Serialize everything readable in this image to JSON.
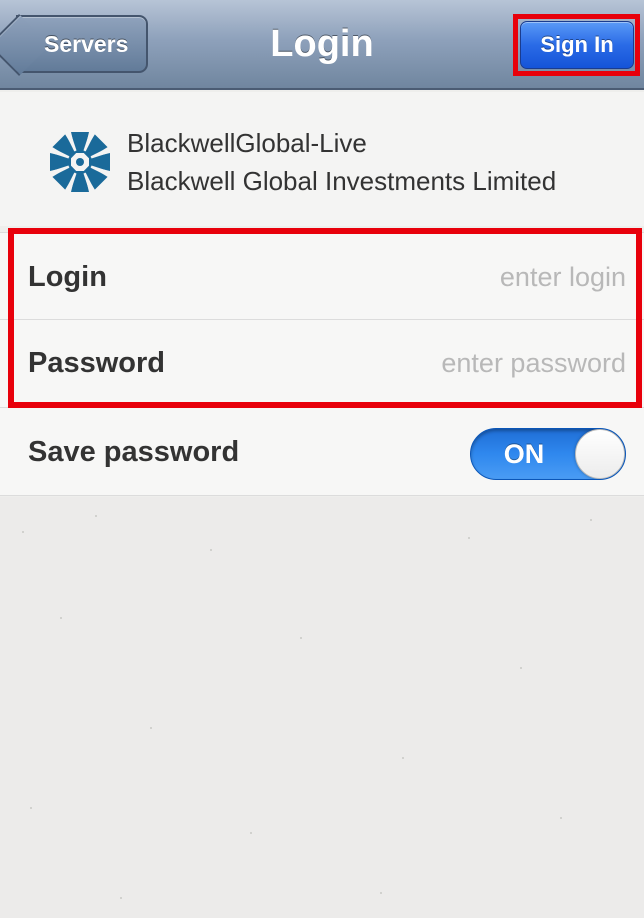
{
  "navbar": {
    "back_label": "Servers",
    "title": "Login",
    "signin_label": "Sign In"
  },
  "server": {
    "name": "BlackwellGlobal-Live",
    "company": "Blackwell Global Investments Limited",
    "logo_icon": "blackwell-global-logo-icon",
    "logo_color": "#1a6a9a"
  },
  "form": {
    "login": {
      "label": "Login",
      "placeholder": "enter login",
      "value": ""
    },
    "password": {
      "label": "Password",
      "placeholder": "enter password",
      "value": ""
    },
    "save_password": {
      "label": "Save password",
      "toggle_text": "ON",
      "enabled": true
    }
  },
  "colors": {
    "navbar": "#8ea1bb",
    "signin_button": "#2a6be6",
    "toggle_on": "#2f88ee",
    "highlight": "#e8000b"
  }
}
